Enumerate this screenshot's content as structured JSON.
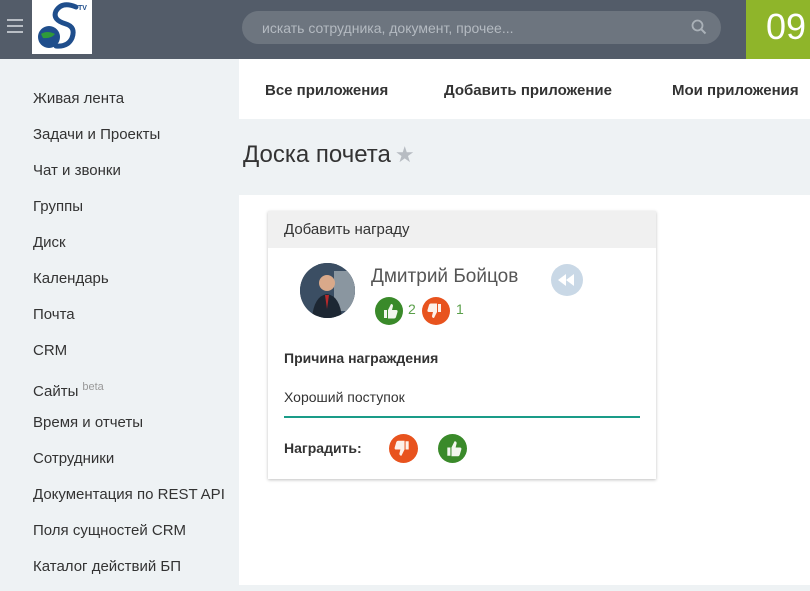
{
  "header": {
    "search": {
      "placeholder": "искать сотрудника, документ, прочее..."
    },
    "clock": "09",
    "logo_superscript": "TV",
    "logo_letter": "S"
  },
  "sidebar": {
    "items": [
      {
        "label": "Живая лента"
      },
      {
        "label": "Задачи и Проекты"
      },
      {
        "label": "Чат и звонки"
      },
      {
        "label": "Группы"
      },
      {
        "label": "Диск"
      },
      {
        "label": "Календарь"
      },
      {
        "label": "Почта"
      },
      {
        "label": "CRM"
      },
      {
        "label": "Сайты",
        "badge": "beta"
      },
      {
        "label": "Время и отчеты"
      },
      {
        "label": "Сотрудники"
      },
      {
        "label": "Документация по REST API"
      },
      {
        "label": "Поля сущностей CRM"
      },
      {
        "label": "Каталог действий БП"
      }
    ]
  },
  "tabs": [
    {
      "label": "Все приложения"
    },
    {
      "label": "Добавить приложение"
    },
    {
      "label": "Мои приложения"
    }
  ],
  "page": {
    "title": "Доска почета"
  },
  "card": {
    "header": "Добавить награду",
    "person_name": "Дмитрий Бойцов",
    "likes": "2",
    "dislikes": "1",
    "reason_label": "Причина награждения",
    "reason_value": "Хороший поступок",
    "reward_label": "Наградить:"
  },
  "colors": {
    "topbar": "#535c69",
    "accent_green": "#8fb52a",
    "input_underline": "#1a9c88",
    "like_green": "#3a8a2a",
    "dislike_orange": "#e8531e"
  },
  "icons": [
    "menu-icon",
    "search-icon",
    "star-icon",
    "back-arrow-icon",
    "thumbs-up-icon",
    "thumbs-down-icon"
  ]
}
